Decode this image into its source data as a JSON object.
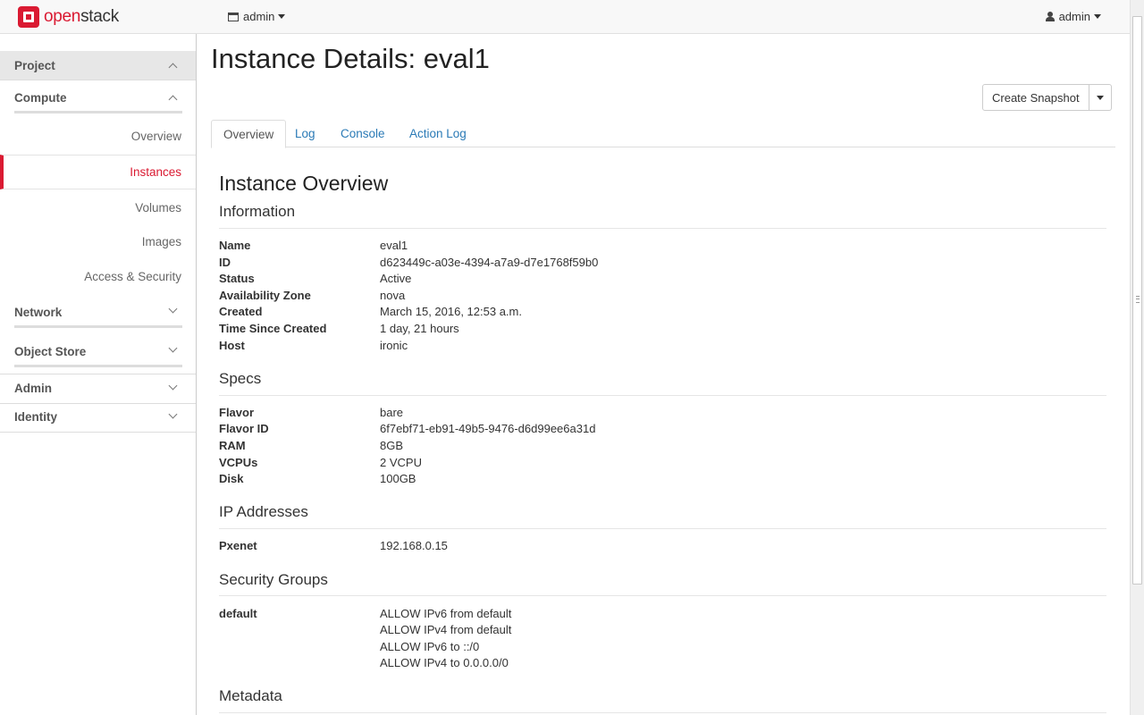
{
  "brand": {
    "name_part1": "open",
    "name_part2": "stack"
  },
  "topbar": {
    "project_label": "admin",
    "user_label": "admin"
  },
  "sidebar": {
    "project": "Project",
    "compute": "Compute",
    "compute_items": [
      "Overview",
      "Instances",
      "Volumes",
      "Images",
      "Access & Security"
    ],
    "network": "Network",
    "object_store": "Object Store",
    "admin": "Admin",
    "identity": "Identity",
    "active_item": "Instances"
  },
  "page": {
    "title": "Instance Details: eval1",
    "create_snapshot": "Create Snapshot",
    "tabs": [
      "Overview",
      "Log",
      "Console",
      "Action Log"
    ],
    "active_tab": "Overview"
  },
  "overview": {
    "title": "Instance Overview",
    "information": {
      "heading": "Information",
      "rows": [
        {
          "label": "Name",
          "value": "eval1"
        },
        {
          "label": "ID",
          "value": "d623449c-a03e-4394-a7a9-d7e1768f59b0"
        },
        {
          "label": "Status",
          "value": "Active"
        },
        {
          "label": "Availability Zone",
          "value": "nova"
        },
        {
          "label": "Created",
          "value": "March 15, 2016, 12:53 a.m."
        },
        {
          "label": "Time Since Created",
          "value": "1 day, 21 hours"
        },
        {
          "label": "Host",
          "value": "ironic"
        }
      ]
    },
    "specs": {
      "heading": "Specs",
      "rows": [
        {
          "label": "Flavor",
          "value": "bare"
        },
        {
          "label": "Flavor ID",
          "value": "6f7ebf71-eb91-49b5-9476-d6d99ee6a31d"
        },
        {
          "label": "RAM",
          "value": "8GB"
        },
        {
          "label": "VCPUs",
          "value": "2 VCPU"
        },
        {
          "label": "Disk",
          "value": "100GB"
        }
      ]
    },
    "ip_addresses": {
      "heading": "IP Addresses",
      "rows": [
        {
          "label": "Pxenet",
          "value": "192.168.0.15"
        }
      ]
    },
    "security_groups": {
      "heading": "Security Groups",
      "group": "default",
      "rules": [
        "ALLOW IPv6 from default",
        "ALLOW IPv4 from default",
        "ALLOW IPv6 to ::/0",
        "ALLOW IPv4 to 0.0.0.0/0"
      ]
    },
    "metadata": {
      "heading": "Metadata"
    }
  },
  "colors": {
    "accent": "#da1a32",
    "link": "#2a7ab6"
  }
}
